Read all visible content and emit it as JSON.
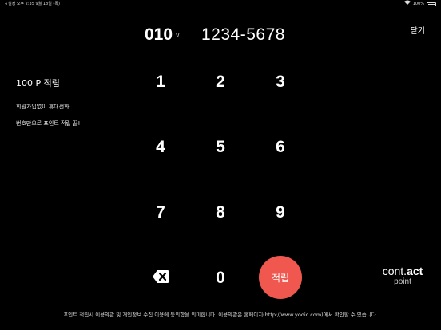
{
  "status_bar": {
    "left": "◂ 설정  오후 2:35  9월 18일 (목)",
    "wifi": "WiFi",
    "battery": "100%",
    "battery_level": 1.0
  },
  "header": {
    "close_label": "닫기",
    "phone_prefix": "010",
    "phone_number_placeholder": "1234-5678"
  },
  "left_panel": {
    "title": "100 P  적립",
    "line1": "회원가입없이 휴대전화",
    "line2": "번호만으로 포인트 적립 끝!"
  },
  "keypad": {
    "k1": "1",
    "k2": "2",
    "k3": "3",
    "k4": "4",
    "k5": "5",
    "k6": "6",
    "k7": "7",
    "k8": "8",
    "k9": "9",
    "k0": "0"
  },
  "submit_label": "적립",
  "logo": {
    "main_prefix": "cont.",
    "main_bold": "act",
    "sub": "point"
  },
  "footer": "포인트 적립시 이용약관 및 개인정보 수집 이용에 동의함을 의미합니다. 이용약관은 홈페이지(http://www.yooic.com)에서 확인할 수 있습니다.",
  "colors": {
    "background": "#000000",
    "accent": "#f0584f"
  }
}
